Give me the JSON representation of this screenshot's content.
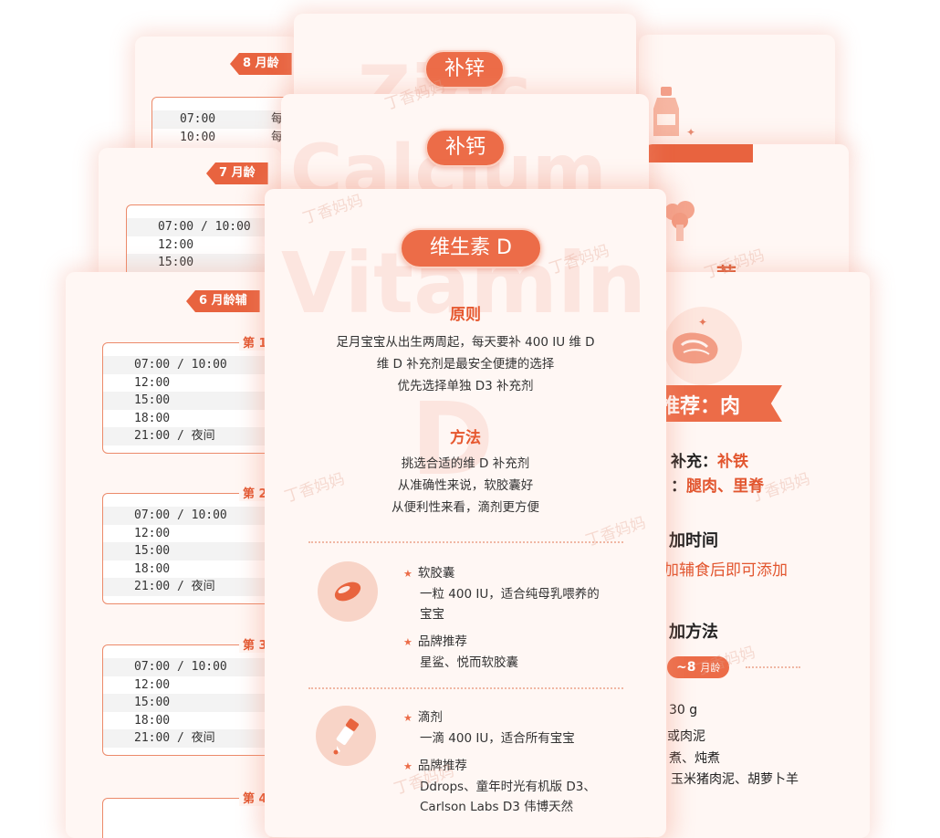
{
  "left_cards": [
    {
      "badge": "8 月龄",
      "rows": [
        "07:00",
        "10:00"
      ],
      "row_tail": [
        "每",
        "每"
      ]
    },
    {
      "badge": "7 月龄",
      "rows": [
        "07:00 / 10:00",
        "12:00",
        "15:00"
      ]
    },
    {
      "badge": "6 月龄辅",
      "days": [
        {
          "tag": "第 1",
          "rows": [
            "07:00 / 10:00",
            "12:00",
            "15:00",
            "18:00",
            "21:00 / 夜间"
          ]
        },
        {
          "tag": "第 2",
          "rows": [
            "07:00 / 10:00",
            "12:00",
            "15:00",
            "18:00",
            "21:00 / 夜间"
          ]
        },
        {
          "tag": "第 3",
          "rows": [
            "07:00 / 10:00",
            "12:00",
            "15:00",
            "18:00",
            "21:00 / 夜间"
          ]
        },
        {
          "tag": "第 4",
          "rows": []
        }
      ]
    }
  ],
  "back_pills": {
    "zinc": "补锌",
    "calcium": "补钙"
  },
  "watermarks": {
    "calcium": "Calcium",
    "vitamin": "Vitamin",
    "d": "D",
    "zinc": "Zinc"
  },
  "main_card": {
    "title": "维生素 D",
    "principle_title": "原则",
    "principle_lines": [
      "足月宝宝从出生两周起，每天要补 400 IU 维 D",
      "维 D 补充剂是最安全便捷的选择",
      "优先选择单独 D3 补充剂"
    ],
    "method_title": "方法",
    "method_lines": [
      "挑选合适的维 D 补充剂",
      "从准确性来说，软胶囊好",
      "从便利性来看，滴剂更方便"
    ],
    "softgel": {
      "icon": "softgel-icon",
      "heading": "软胶囊",
      "lines": [
        "一粒 400 IU，适合纯母乳喂养的",
        "宝宝"
      ],
      "brand_heading": "品牌推荐",
      "brand_lines": [
        "星鲨、悦而软胶囊"
      ]
    },
    "drops": {
      "icon": "dropper-icon",
      "heading": "滴剂",
      "lines": [
        "一滴 400 IU，适合所有宝宝"
      ],
      "brand_heading": "品牌推荐",
      "brand_lines": [
        "Ddrops、童年时光有机版 D3、",
        "Carlson Labs D3 伟博天然"
      ]
    }
  },
  "right_card": {
    "back_title_fragment": "荐",
    "title": "推荐：肉",
    "supplement_label": "补充：",
    "supplement_value": "补铁",
    "parts_label": "：",
    "parts_value": "腿肉、里脊",
    "time_title": "加时间",
    "time_value": "加辅食后即可添加",
    "method_title": "加方法",
    "age_badge_num": "~8",
    "age_badge_unit": "月龄",
    "lines": [
      "30 g",
      "或肉泥",
      "煮、炖煮",
      "玉米猪肉泥、胡萝卜羊"
    ]
  },
  "logo_watermark": "丁香妈妈",
  "colors": {
    "accent": "#ec6c48",
    "accent_dark": "#e2562f",
    "card_bg": "#fff7f4"
  }
}
